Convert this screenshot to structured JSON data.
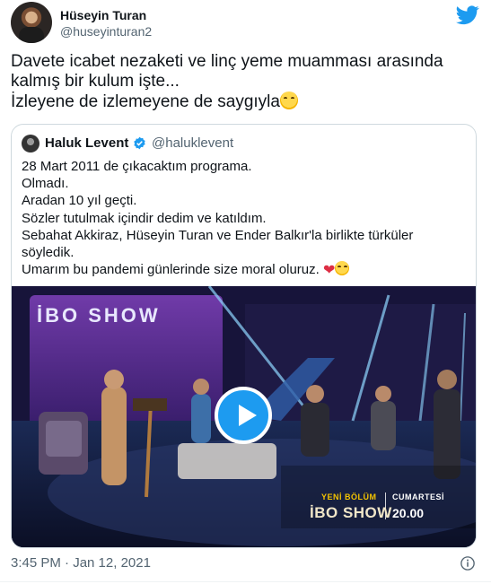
{
  "author": {
    "name": "Hüseyin Turan",
    "handle": "@huseyinturan2"
  },
  "tweet": {
    "line1": "Davete icabet nezaketi ve linç yeme muamması arasında",
    "line2": "kalmış bir kulum işte...",
    "line3": "İzleyene de izlemeyene de saygıyla"
  },
  "quoted": {
    "name": "Haluk Levent",
    "handle": "@haluklevent",
    "lines": [
      "28 Mart 2011 de çıkacaktım programa.",
      "Olmadı.",
      "Aradan 10 yıl geçti.",
      "Sözler tutulmak içindir dedim ve katıldım.",
      "Sebahat Akkiraz, Hüseyin Turan ve Ender Balkır'la birlikte türküler",
      "söyledik.",
      "Umarım bu pandemi günlerinde size moral oluruz."
    ],
    "video_overlay": {
      "new_episode": "YENİ BÖLÜM",
      "day": "CUMARTESİ",
      "show": "İBO SHOW",
      "time": "20.00",
      "set_sign": "İBO SHOW"
    }
  },
  "timestamp": "3:45 PM · Jan 12, 2021",
  "colors": {
    "accent": "#1d9bf0",
    "text": "#0f1419",
    "muted": "#536471",
    "border": "#cfd9de"
  },
  "icons": [
    "twitter-bird-icon",
    "verified-badge-icon",
    "play-icon",
    "info-icon"
  ]
}
